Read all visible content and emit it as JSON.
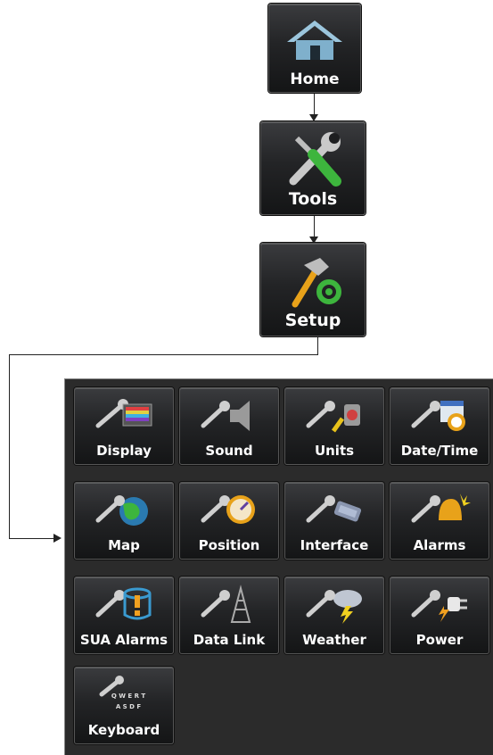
{
  "nav": {
    "home": {
      "label": "Home",
      "icon": "home-icon"
    },
    "tools": {
      "label": "Tools",
      "icon": "tools-icon"
    },
    "setup": {
      "label": "Setup",
      "icon": "setup-icon"
    }
  },
  "setup_menu": {
    "items": [
      {
        "label": "Display",
        "icon": "display-icon"
      },
      {
        "label": "Sound",
        "icon": "sound-icon"
      },
      {
        "label": "Units",
        "icon": "units-icon"
      },
      {
        "label": "Date/Time",
        "icon": "date-time-icon"
      },
      {
        "label": "Map",
        "icon": "map-icon"
      },
      {
        "label": "Position",
        "icon": "position-icon"
      },
      {
        "label": "Interface",
        "icon": "interface-icon"
      },
      {
        "label": "Alarms",
        "icon": "alarms-icon"
      },
      {
        "label": "SUA Alarms",
        "icon": "sua-alarms-icon"
      },
      {
        "label": "Data Link",
        "icon": "data-link-icon"
      },
      {
        "label": "Weather",
        "icon": "weather-icon"
      },
      {
        "label": "Power",
        "icon": "power-icon"
      },
      {
        "label": "Keyboard",
        "icon": "keyboard-icon"
      }
    ]
  },
  "keyboard_icon_text": {
    "row1": "Q W E R T",
    "row2": "A S D F"
  }
}
